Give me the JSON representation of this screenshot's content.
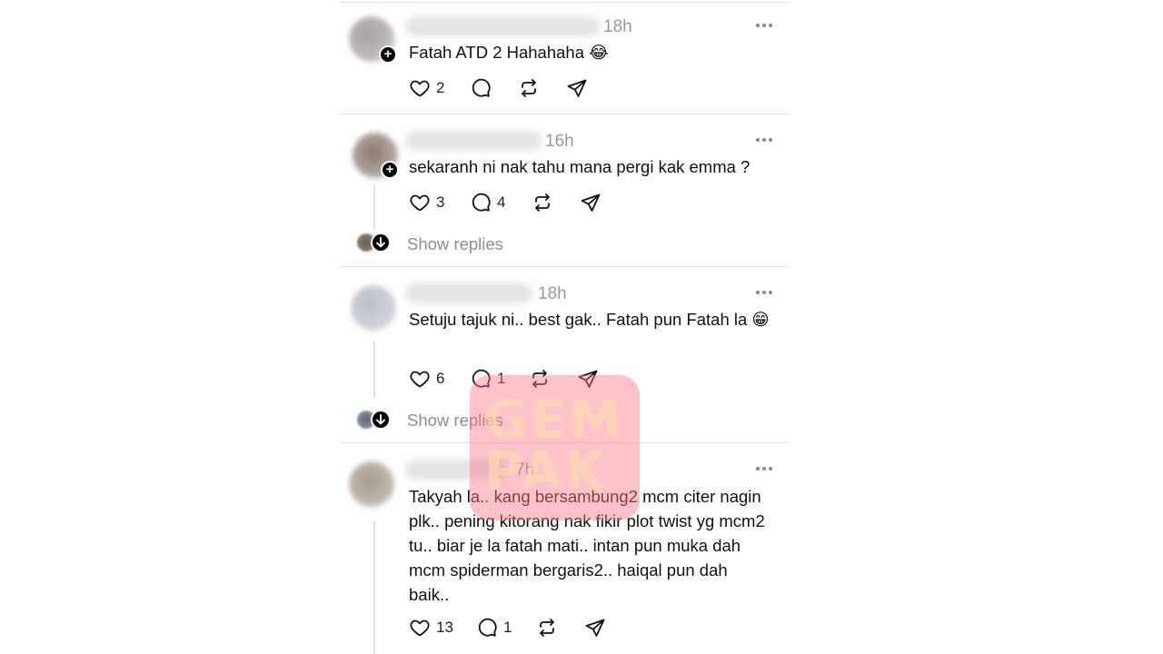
{
  "posts": [
    {
      "time": "18h",
      "text": "Fatah ATD 2 Hahahaha 😂",
      "likes": "2",
      "replies": "",
      "show_replies": ""
    },
    {
      "time": "16h",
      "text": "sekaranh ni nak tahu mana pergi kak emma ?",
      "likes": "3",
      "replies": "4",
      "show_replies": "Show replies"
    },
    {
      "time": "18h",
      "text": "Setuju tajuk ni.. best gak.. Fatah pun Fatah la 😁",
      "likes": "6",
      "replies": "1",
      "show_replies": "Show replies"
    },
    {
      "time": "7h",
      "text": "Takyah la.. kang bersambung2 mcm citer nagin plk.. pening kitorang nak fikir plot twist yg mcm2 tu.. biar je la fatah mati.. intan pun muka dah mcm spiderman bergaris2.. haiqal pun dah baik..",
      "likes": "13",
      "replies": "1",
      "show_replies": ""
    }
  ],
  "watermark": {
    "line1": "GEM",
    "line2": "PAK"
  },
  "icons": {
    "like": "heart-icon",
    "reply": "comment-icon",
    "repost": "repost-icon",
    "share": "send-icon",
    "more": "more-icon",
    "expand": "arrow-down-icon"
  },
  "colors": {
    "muted": "#999999",
    "divider": "#e3e3e3",
    "watermark": "#ff788c"
  }
}
